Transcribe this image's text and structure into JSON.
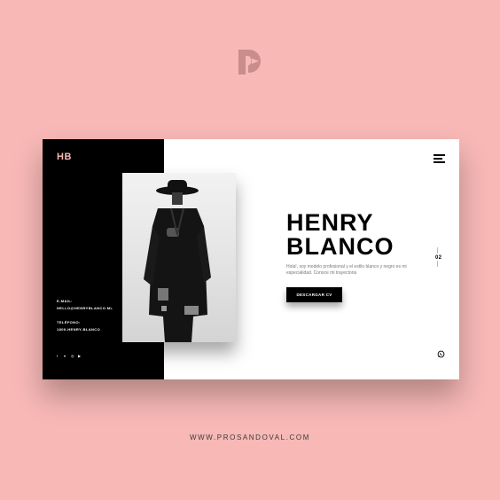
{
  "colors": {
    "background": "#f7b8b6",
    "accent": "#f7b8b6",
    "dark": "#000000",
    "card": "#ffffff"
  },
  "brand": {
    "initials": "HB"
  },
  "contact": {
    "email_label": "E-MAIL:",
    "email_value": "HELLO@HENRYBLANCO.ML",
    "phone_label": "TELÉFONO:",
    "phone_value": "1800-HENRY-BLANCO"
  },
  "socials": [
    "facebook-icon",
    "twitter-icon",
    "instagram-icon",
    "youtube-icon"
  ],
  "hero": {
    "first_name": "HENRY",
    "last_name": "BLANCO",
    "bio": "Hola!, soy modelo profesional y el estilo blanco y negro es mi especialidad. Conoce mi trayectoria",
    "cta_label": "DESCARGAR CV"
  },
  "slider": {
    "current": "02"
  },
  "footer": {
    "website": "WWW.PROSANDOVAL.COM"
  }
}
